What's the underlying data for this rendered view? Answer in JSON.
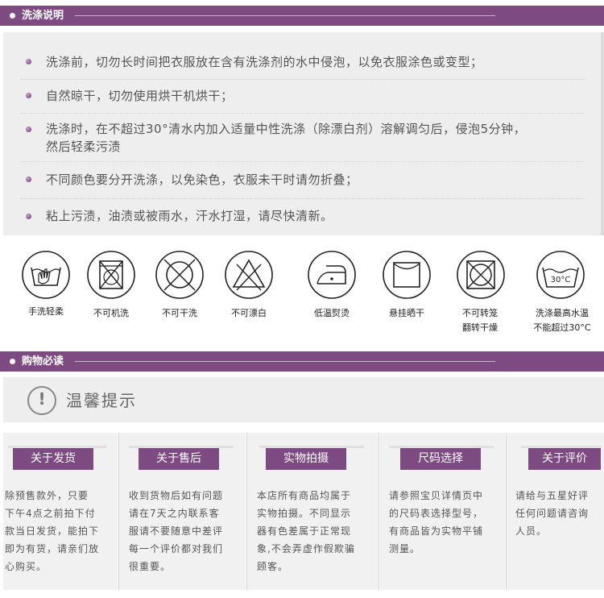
{
  "care_header": {
    "title": "洗涤说明"
  },
  "care_items": [
    {
      "text": "洗涤前，切勿长时间把衣服放在含有洗涤剂的水中侵泡，以免衣服涂色或变型；"
    },
    {
      "text": "自然晾干，切勿使用烘干机烘干；"
    },
    {
      "text": "洗涤时，在不超过30°清水内加入适量中性洗涤（除漂白剂）溶解调匀后，侵泡5分钟，",
      "text2": "然后轻柔污渍"
    },
    {
      "text": "不同颜色要分开洗涤，以免染色，衣服未干时请勿折叠；"
    },
    {
      "text": "粘上污渍，油渍或被雨水，汗水打湿，请尽快清新。"
    }
  ],
  "care_symbols": [
    {
      "icon": "hand-wash-icon",
      "label": "手洗轻柔"
    },
    {
      "icon": "no-machine-wash-icon",
      "label": "不可机洗"
    },
    {
      "icon": "no-dry-clean-icon",
      "label": "不可干洗"
    },
    {
      "icon": "no-bleach-icon",
      "label": "不可漂白"
    },
    {
      "icon": "low-iron-icon",
      "label": "低温熨烫"
    },
    {
      "icon": "hang-dry-icon",
      "label": "悬挂晒干"
    },
    {
      "icon": "no-tumble-dry-icon",
      "label": "不可转笼",
      "label2": "翻转干燥"
    },
    {
      "icon": "wash-30-icon",
      "label": "洗涤最高水温",
      "label2": "不能超过30°C",
      "badge": "30°C"
    }
  ],
  "shopping_header": {
    "title": "购物必读"
  },
  "notice": {
    "icon": "exclamation-icon",
    "glyph": "!",
    "title": "温馨提示"
  },
  "columns": [
    {
      "tab": "关于发货",
      "text": [
        "除预售款外，只要",
        "下午4点之前拍下付",
        "款当日发货，能拍下",
        "即为有货，请亲们放",
        "心购买。"
      ]
    },
    {
      "tab": "关于售后",
      "text": [
        "收到货物后如有问题",
        "请在7天之内联系客",
        "服请不要随意中差评",
        "每一个评价都对我们",
        "很重要。"
      ]
    },
    {
      "tab": "实物拍摄",
      "text": [
        "本店所有商品均属于",
        "实物拍摄。不同显示",
        "器有色差属于正常现",
        "象,不会弄虚作假欺骗",
        "顾客。"
      ]
    },
    {
      "tab": "尺码选择",
      "text": [
        "请参照宝贝详情页中",
        "的尺码表选择型号，",
        "有商品皆为实物平铺",
        "测量。"
      ]
    },
    {
      "tab": "关于评价",
      "text": [
        "请给与五星好评",
        "任何问题请咨询",
        "人员。"
      ]
    }
  ],
  "colors": {
    "accent": "#7d4a82",
    "panel": "#eeeeee"
  }
}
